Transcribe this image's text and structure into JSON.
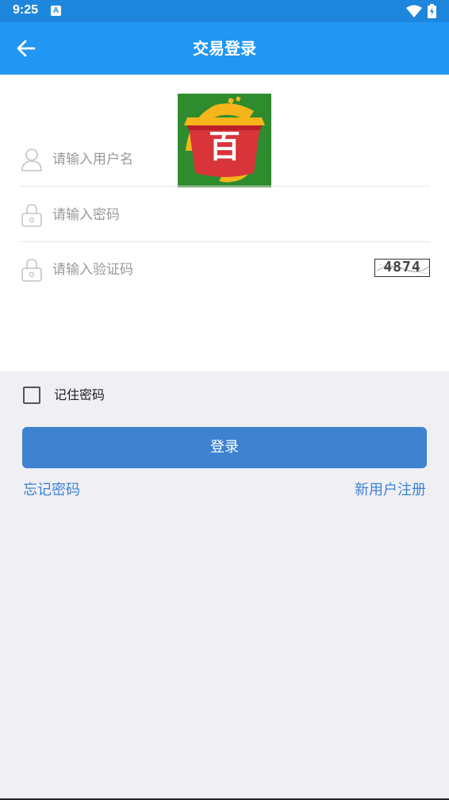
{
  "status_bar": {
    "time": "9:25",
    "notification_letter": "A"
  },
  "app_bar": {
    "title": "交易登录",
    "back_icon": "arrow-left-icon"
  },
  "logo": {
    "character": "百",
    "colors": {
      "background": "#2e8b2e",
      "bowl": "#d8343a",
      "swoosh": "#f5b51b"
    }
  },
  "form": {
    "username": {
      "placeholder": "请输入用户名",
      "value": "",
      "icon": "user-icon"
    },
    "password": {
      "placeholder": "请输入密码",
      "value": "",
      "icon": "lock-icon"
    },
    "captcha": {
      "placeholder": "请输入验证码",
      "value": "",
      "icon": "lock-icon",
      "code": "4874"
    }
  },
  "remember": {
    "label": "记住密码",
    "checked": false
  },
  "login_button": {
    "label": "登录"
  },
  "links": {
    "forgot": "忘记密码",
    "register": "新用户注册"
  },
  "colors": {
    "status_bar": "#1e86dc",
    "app_bar": "#2196f3",
    "accent": "#3e82d0",
    "background": "#efeff4"
  }
}
